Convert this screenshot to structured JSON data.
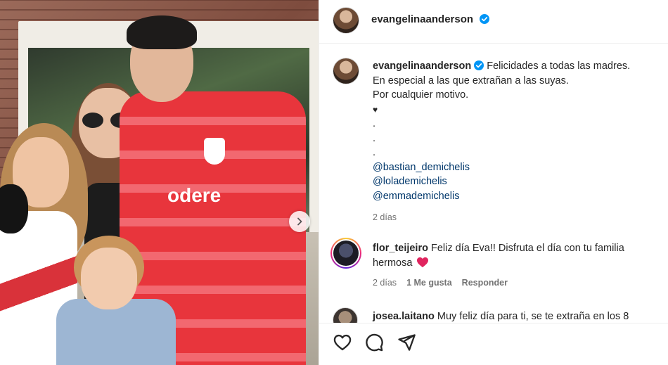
{
  "post": {
    "username": "evangelinaanderson",
    "caption_lines": [
      "Felicidades a todas las madres.",
      "En especial a las que extrañan a las suyas.",
      "Por cualquier motivo.",
      "♥",
      ".",
      ".",
      "."
    ],
    "mentions": [
      "@bastian_demichelis",
      "@lolademichelis",
      "@emmademichelis"
    ],
    "time": "2 días",
    "shirt_brand": "odere"
  },
  "comments": [
    {
      "username": "flor_teijeiro",
      "text": "Feliz día Eva!! Disfruta el día con tu familia hermosa",
      "time": "2 días",
      "likes": "1 Me gusta",
      "reply_label": "Responder"
    },
    {
      "username": "josea.laitano",
      "text": "Muy feliz día para ti, se te extraña en los 8"
    }
  ],
  "icons": {
    "verified": "verified-badge-icon",
    "like": "heart-icon",
    "comment": "comment-bubble-icon",
    "share": "paper-plane-icon",
    "next": "chevron-right-icon"
  },
  "colors": {
    "verified": "#0095f6",
    "mention": "#00376b",
    "meta": "#737373",
    "heart_emoji": "#e0245e"
  }
}
